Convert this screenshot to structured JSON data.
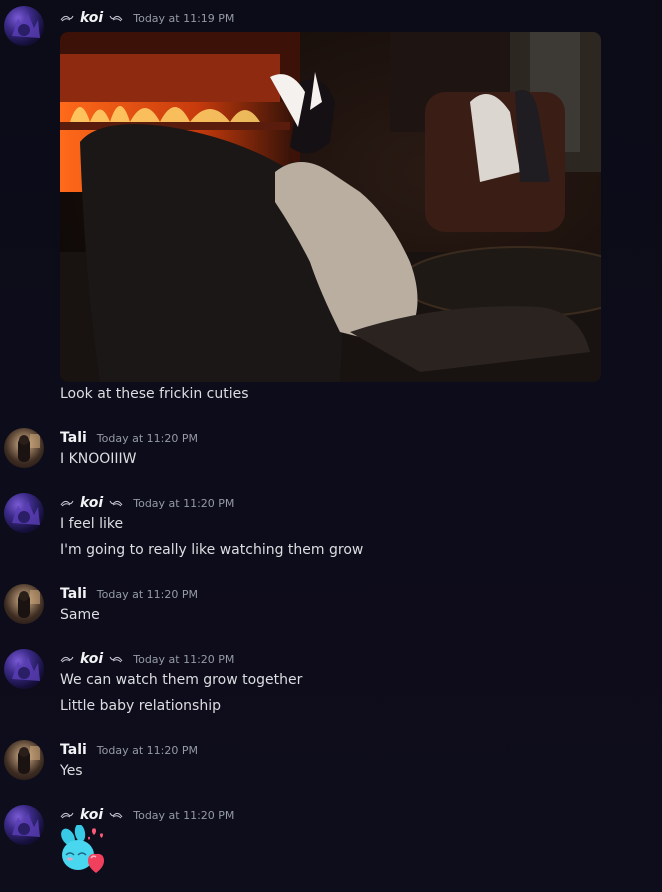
{
  "messages": [
    {
      "author": "koi",
      "timestamp": "Today at 11:19 PM",
      "attachment": "screenshot-image",
      "lines": [
        "Look at these frickin cuties"
      ]
    },
    {
      "author": "Tali",
      "timestamp": "Today at 11:20 PM",
      "lines": [
        "I KNOOIIIW"
      ]
    },
    {
      "author": "koi",
      "timestamp": "Today at 11:20 PM",
      "lines": [
        "I feel like",
        "I'm going to really like watching them grow"
      ]
    },
    {
      "author": "Tali",
      "timestamp": "Today at 11:20 PM",
      "lines": [
        "Same"
      ]
    },
    {
      "author": "koi",
      "timestamp": "Today at 11:20 PM",
      "lines": [
        "We can watch them grow together",
        "Little baby relationship"
      ]
    },
    {
      "author": "Tali",
      "timestamp": "Today at 11:20 PM",
      "lines": [
        "Yes"
      ]
    },
    {
      "author": "koi",
      "timestamp": "Today at 11:20 PM",
      "sticker": "bunny-heart-sticker"
    }
  ],
  "colors": {
    "background": "#0d0c1a",
    "username": "#f2f3f5",
    "timestamp": "#949ba4",
    "text": "#dbdee1"
  }
}
